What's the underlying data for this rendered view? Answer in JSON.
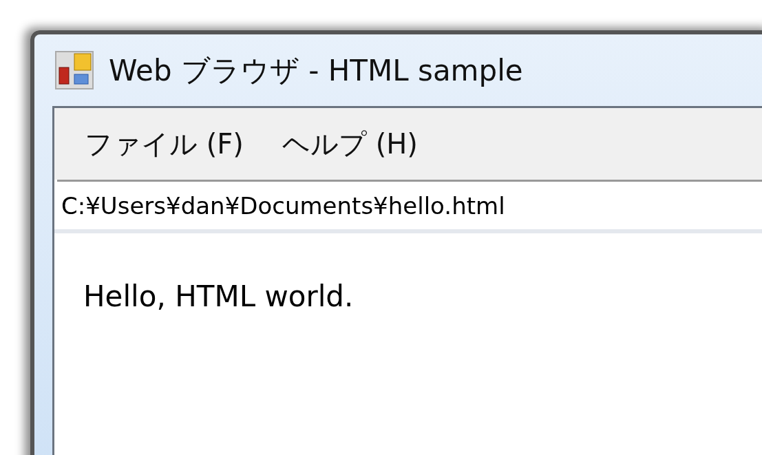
{
  "window": {
    "title": "Web ブラウザ - HTML sample"
  },
  "menu": [
    {
      "label": "ファイル (F)"
    },
    {
      "label": "ヘルプ (H)"
    }
  ],
  "address": {
    "value": "C:¥Users¥dan¥Documents¥hello.html"
  },
  "content": {
    "text": "Hello, HTML world."
  }
}
